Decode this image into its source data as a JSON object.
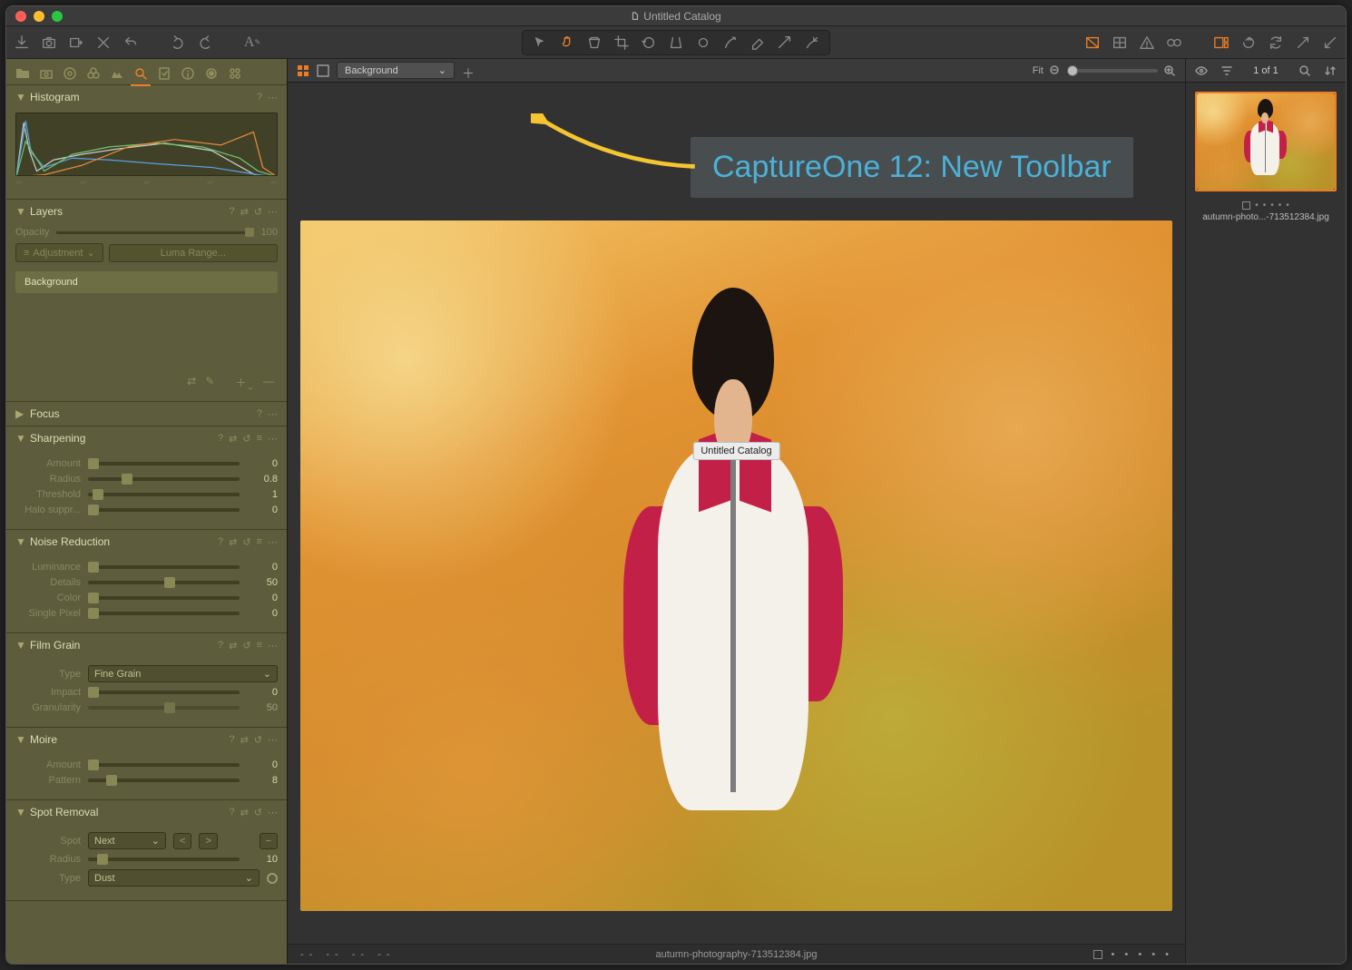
{
  "window": {
    "title": "Untitled Catalog"
  },
  "callout": "CaptureOne 12: New Toolbar",
  "tooltip": "Untitled Catalog",
  "viewer": {
    "layerSelect": "Background",
    "fitLabel": "Fit",
    "fileName": "autumn-photography-713512384.jpg"
  },
  "browser": {
    "count": "1 of 1",
    "thumbName": "autumn-photo...-713512384.jpg"
  },
  "panels": {
    "histogram": {
      "title": "Histogram"
    },
    "layers": {
      "title": "Layers",
      "opacityLabel": "Opacity",
      "opacityValue": "100",
      "adjustLabel": "Adjustment",
      "lumaLabel": "Luma Range...",
      "bgLayer": "Background"
    },
    "focus": {
      "title": "Focus"
    },
    "sharpening": {
      "title": "Sharpening",
      "amountLabel": "Amount",
      "amountVal": "0",
      "radiusLabel": "Radius",
      "radiusVal": "0.8",
      "thresholdLabel": "Threshold",
      "thresholdVal": "1",
      "haloLabel": "Halo suppr...",
      "haloVal": "0"
    },
    "nr": {
      "title": "Noise Reduction",
      "lumLabel": "Luminance",
      "lumVal": "0",
      "detLabel": "Details",
      "detVal": "50",
      "colorLabel": "Color",
      "colorVal": "0",
      "spLabel": "Single Pixel",
      "spVal": "0"
    },
    "grain": {
      "title": "Film Grain",
      "typeLabel": "Type",
      "typeVal": "Fine Grain",
      "impactLabel": "Impact",
      "impactVal": "0",
      "granLabel": "Granularity",
      "granVal": "50"
    },
    "moire": {
      "title": "Moire",
      "amtLabel": "Amount",
      "amtVal": "0",
      "patLabel": "Pattern",
      "patVal": "8"
    },
    "spot": {
      "title": "Spot Removal",
      "spotLabel": "Spot",
      "spotSel": "Next",
      "radLabel": "Radius",
      "radVal": "10",
      "typeLabel": "Type",
      "typeVal": "Dust"
    }
  }
}
